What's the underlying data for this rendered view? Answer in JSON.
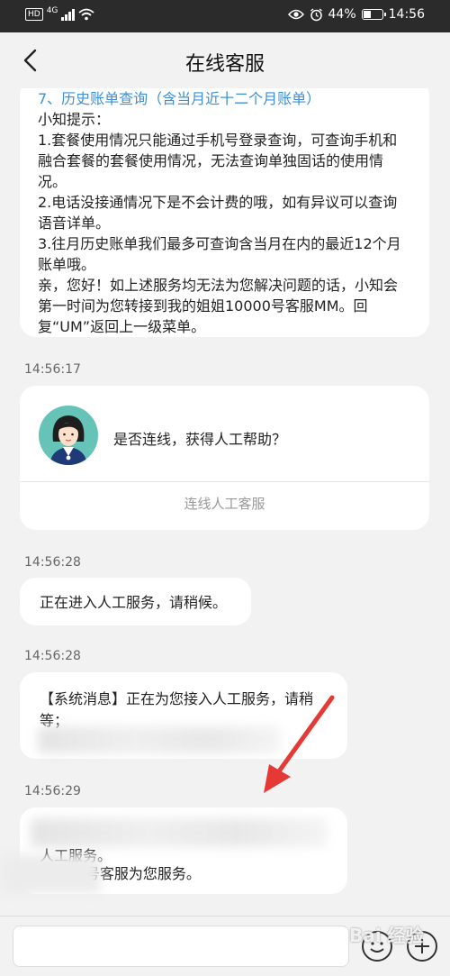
{
  "status_bar": {
    "hd": "HD",
    "network": "4G",
    "battery_percent": "44%",
    "battery_level": 0.44,
    "time": "14:56"
  },
  "nav": {
    "title": "在线客服"
  },
  "messages": {
    "m1": {
      "link": "7、历史账单查询（含当月近十二个月账单）",
      "lines": [
        "小知提示：",
        "1.套餐使用情况只能通过手机号登录查询，可查询手机和融合套餐的套餐使用情况，无法查询单独固话的使用情况。",
        "2.电话没接通情况下是不会计费的哦，如有异议可以查询语音详单。",
        "3.往月历史账单我们最多可查询含当月在内的最近12个月账单哦。",
        "亲，您好！如上述服务均无法为您解决问题的话，小知会第一时间为您转接到我的姐姐10000号客服MM。回复“UM”返回上一级菜单。"
      ]
    },
    "ts1": "14:56:17",
    "card": {
      "question": "是否连线，获得人工帮助？",
      "action": "连线人工客服"
    },
    "ts2": "14:56:28",
    "m3": "正在进入人工服务，请稍候。",
    "ts3": "14:56:28",
    "m4": {
      "line1": "【系统消息】正在为您接入人工服务，请稍",
      "line2": "等；"
    },
    "ts4": "14:56:29",
    "m5": {
      "line1": "人工服务。",
      "line2": "27142号客服为您服务。"
    }
  },
  "watermark": "Bai 经验",
  "colors": {
    "link": "#3d8fd6",
    "arrow": "#e53935",
    "avatar_bg": "#66c3b8"
  }
}
